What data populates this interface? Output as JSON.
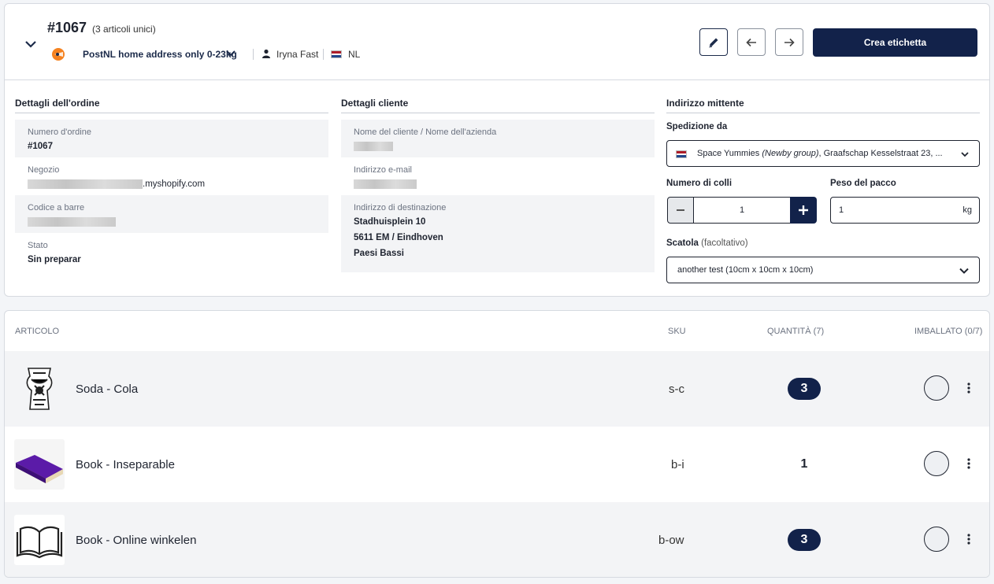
{
  "header": {
    "order_number": "#1067",
    "order_subtitle": "(3 articoli unici)",
    "carrier": "PostNL home address only 0-23kg",
    "customer": "Iryna Fast",
    "country": "NL",
    "create_label_button": "Crea etichetta"
  },
  "order_details": {
    "title": "Dettagli dell'ordine",
    "order_number_label": "Numero d'ordine",
    "order_number_value": "#1067",
    "store_label": "Negozio",
    "store_value": ".myshopify.com",
    "barcode_label": "Codice a barre",
    "status_label": "Stato",
    "status_value": "Sin preparar"
  },
  "customer_details": {
    "title": "Dettagli cliente",
    "name_label": "Nome del cliente / Nome dell'azienda",
    "email_label": "Indirizzo e-mail",
    "address_label": "Indirizzo di destinazione",
    "address_line1": "Stadhuisplein 10",
    "address_line2": "5611 EM / Eindhoven",
    "address_line3": "Paesi Bassi"
  },
  "sender": {
    "title": "Indirizzo mittente",
    "ship_from_label": "Spedizione da",
    "ship_from_name": "Space Yummies ",
    "ship_from_group": "(Newby group)",
    "ship_from_rest": ", Graafschap Kesselstraat 23, ...",
    "parcels_label": "Numero di colli",
    "parcels_value": "1",
    "weight_label": "Peso del pacco",
    "weight_value": "1",
    "weight_unit": "kg",
    "box_label": "Scatola",
    "box_optional": "(facoltativo)",
    "box_value": "another test (10cm x 10cm x 10cm)"
  },
  "items_table": {
    "headers": {
      "article": "ARTICOLO",
      "sku": "SKU",
      "quantity": "QUANTITÀ (7)",
      "packed": "IMBALLATO (0/7)"
    },
    "rows": [
      {
        "name": "Soda - Cola",
        "sku": "s-c",
        "qty": "3"
      },
      {
        "name": "Book - Inseparable",
        "sku": "b-i",
        "qty": "1"
      },
      {
        "name": "Book - Online winkelen",
        "sku": "b-ow",
        "qty": "3"
      }
    ]
  },
  "colors": {
    "primary": "#12224a",
    "border": "#d6dae0",
    "row_alt": "#f3f4f6"
  }
}
